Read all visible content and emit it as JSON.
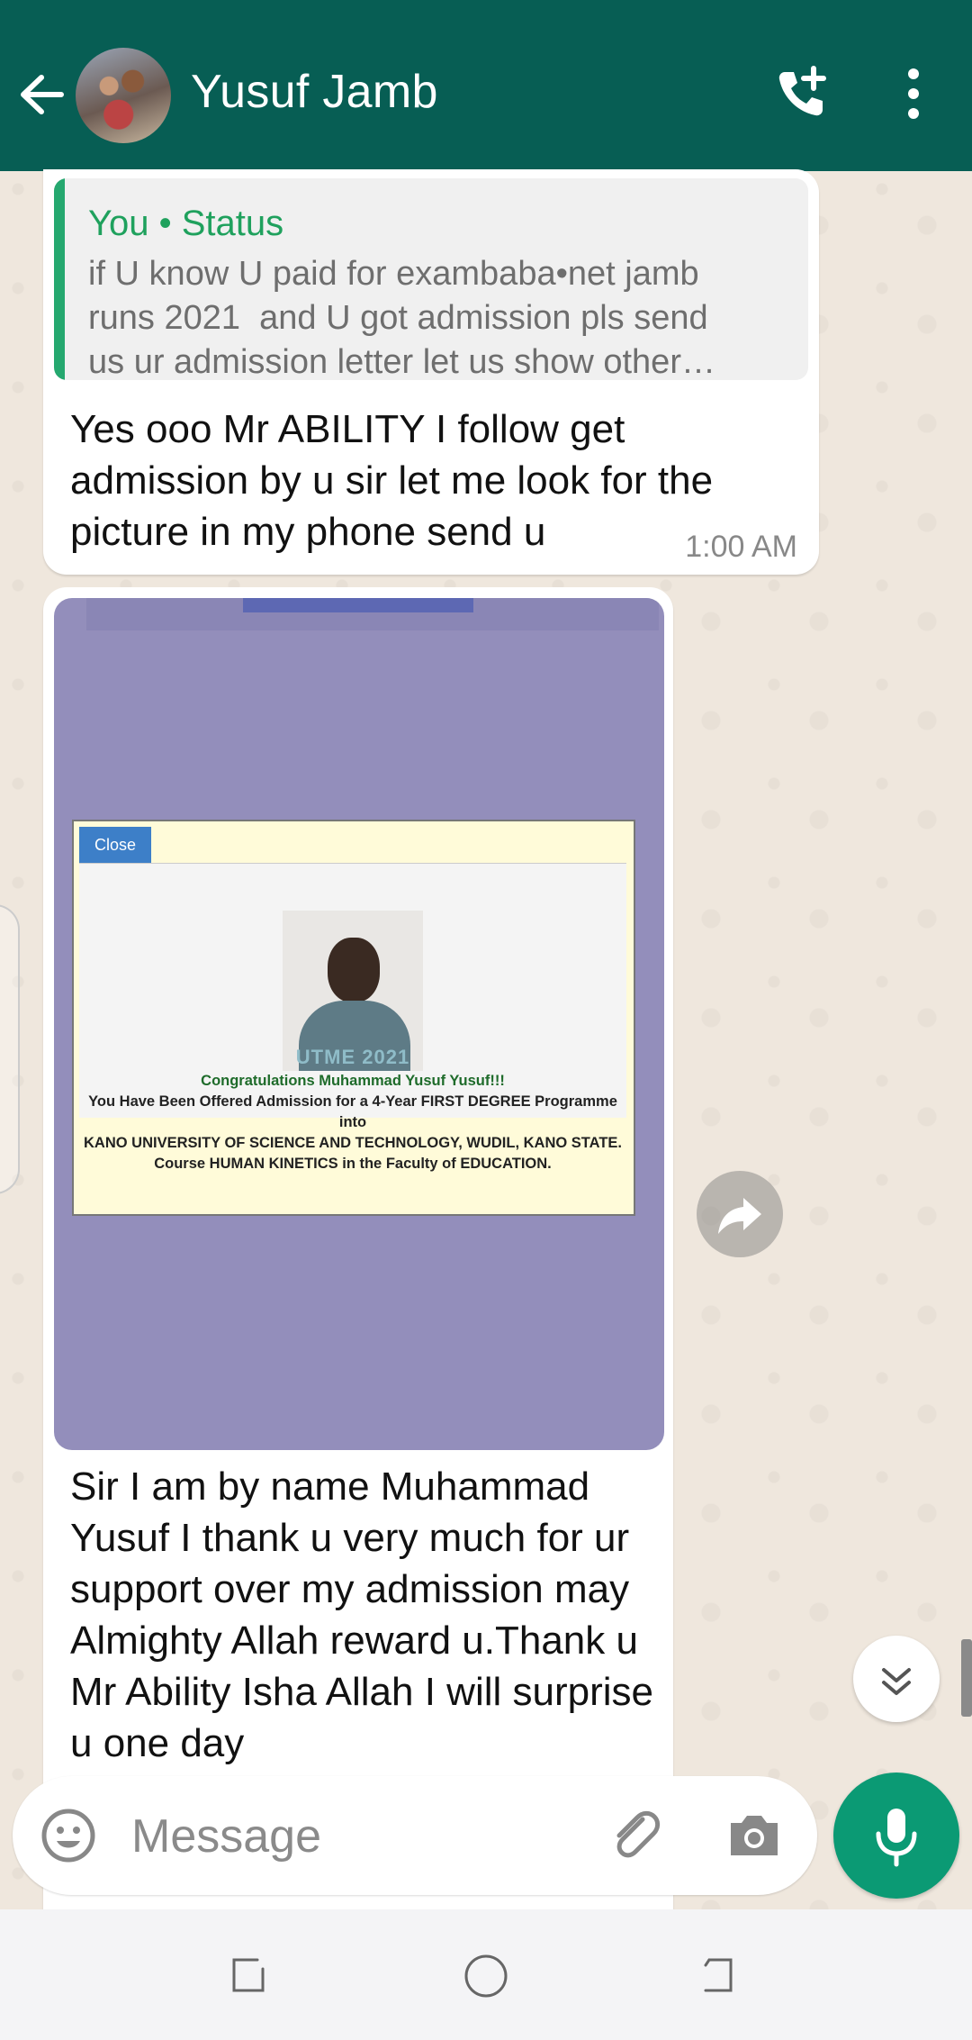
{
  "header": {
    "contact_name": "Yusuf Jamb",
    "back_icon": "arrow-left-icon",
    "call_icon": "add-call-icon",
    "menu_icon": "more-vertical-icon",
    "color": "#075e54"
  },
  "messages": [
    {
      "quote": {
        "title": "You • Status",
        "text": "if U know U paid for exambaba•net jamb\nruns 2021  and U got admission pls send\nus ur admission letter let us show other…"
      },
      "text": "Yes ooo Mr ABILITY I follow get admission by u sir let me look for the picture in my phone send u",
      "time": "1:00 AM"
    },
    {
      "image": {
        "close_label": "Close",
        "photo_watermark": "UTME 2021",
        "cert_title": "Congratulations Muhammad Yusuf Yusuf!!!",
        "cert_line1": "You Have Been Offered Admission for a 4-Year FIRST DEGREE Programme into",
        "cert_line2": "KANO UNIVERSITY OF SCIENCE AND TECHNOLOGY, WUDIL, KANO STATE.",
        "cert_line3": "Course HUMAN KINETICS in the Faculty of EDUCATION."
      },
      "text": "Sir I am by name Muhammad Yusuf I thank u very much for ur support over my admission may Almighty Allah reward u.Thank u Mr Ability Isha Allah I will surprise u one day"
    }
  ],
  "input": {
    "placeholder": "Message"
  },
  "icons": {
    "emoji": "emoji-icon",
    "attach": "paperclip-icon",
    "camera": "camera-icon",
    "mic": "microphone-icon",
    "forward": "forward-icon",
    "scroll_down": "double-chevron-down-icon"
  },
  "accent": "#0b9a74"
}
